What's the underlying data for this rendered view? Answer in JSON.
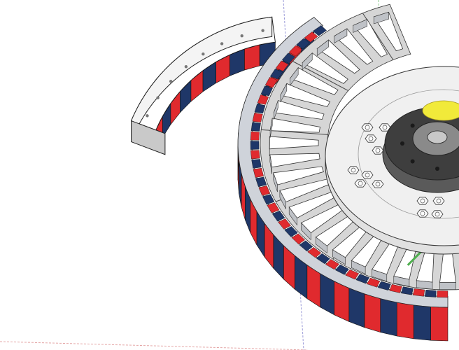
{
  "app": {
    "name": ""
  },
  "scene": {
    "colors": {
      "background": "#ffffff",
      "red_magnet": "#e02a2e",
      "blue_magnet": "#1f3768",
      "housing": "#ffffff",
      "housing_shade": "#d6d6d6",
      "hub": "#f0f0f0",
      "shaft": "#3e3e3e",
      "yellow_highlight": "#f1ea3a",
      "green_axis": "#6fbf6f",
      "red_axis": "#d98080",
      "blue_axis": "#7070c8"
    },
    "objects": [
      {
        "name": "magnet-segment",
        "shape": "arc"
      },
      {
        "name": "motor-assembly",
        "shape": "ring"
      },
      {
        "name": "stator-teeth",
        "shape": "radial"
      },
      {
        "name": "hub",
        "shape": "disc"
      },
      {
        "name": "shaft-bearing",
        "shape": "disc"
      }
    ]
  }
}
